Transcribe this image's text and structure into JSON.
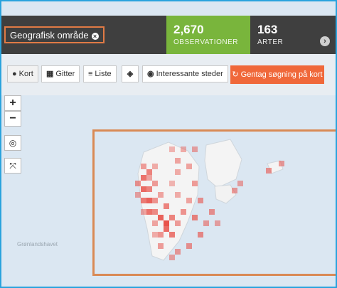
{
  "filter": {
    "label": "Geografisk område"
  },
  "stats": {
    "observations": {
      "value": "2,670",
      "label": "OBSERVATIONER"
    },
    "species": {
      "value": "163",
      "label": "ARTER"
    }
  },
  "toolbar": {
    "map_label": "Kort",
    "grid_label": "Gitter",
    "list_label": "Liste",
    "places_label": "Interessante steder",
    "search_label": "Gentag søgning på kort"
  },
  "map": {
    "zoom_in": "+",
    "zoom_out": "−",
    "sea_label": "Grønlandshavet"
  },
  "colors": {
    "accent": "#f0683a",
    "stat_green": "#79b53c",
    "cell": "#e8524a",
    "selection": "#d98a55"
  }
}
